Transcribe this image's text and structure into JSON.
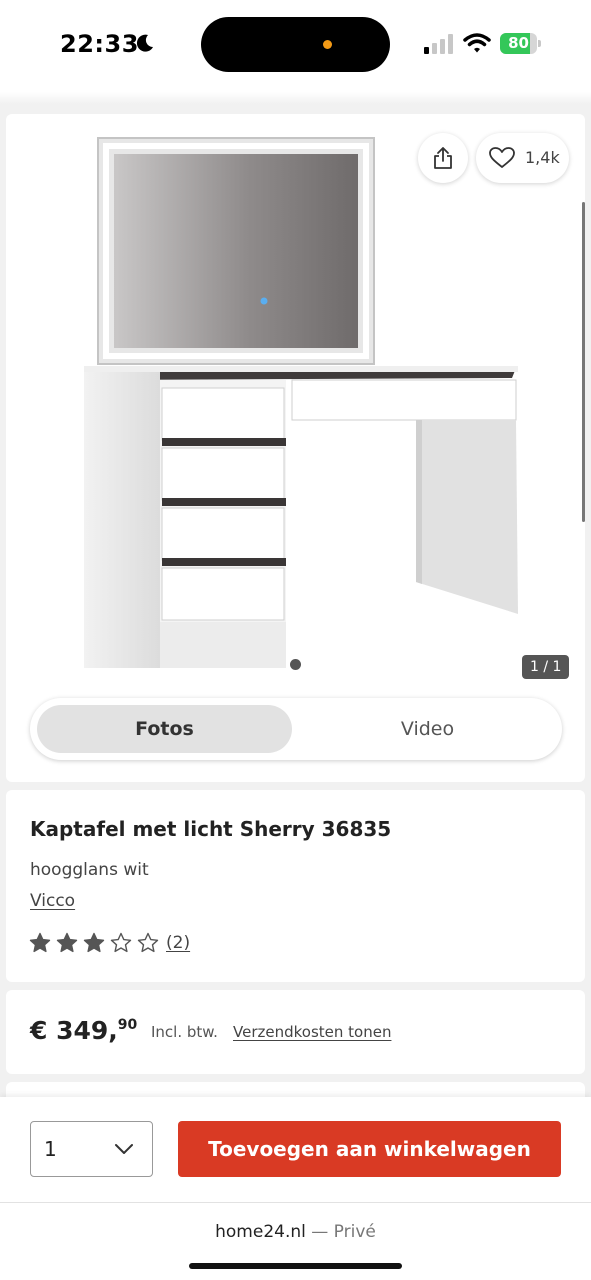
{
  "status_bar": {
    "time": "22:33",
    "battery": "80",
    "battery_level": 0.8,
    "icons": [
      "moon-icon",
      "signal-icon",
      "wifi-icon",
      "battery-icon"
    ]
  },
  "gallery": {
    "like_count": "1,4k",
    "image_counter": "1 / 1",
    "tabs": [
      {
        "label": "Fotos",
        "active": true
      },
      {
        "label": "Video",
        "active": false
      }
    ]
  },
  "product": {
    "title": "Kaptafel met licht Sherry 36835",
    "variant": "hoogglans wit",
    "brand": "Vicco",
    "rating": 3,
    "rating_max": 5,
    "review_count": "(2)"
  },
  "price": {
    "main": "€ 349,",
    "cents": "90",
    "vat": "Incl. btw.",
    "shipping_link": "Verzendkosten tonen"
  },
  "cart": {
    "quantity": "1",
    "add_button": "Toevoegen aan winkelwagen"
  },
  "browser": {
    "domain": "home24.nl",
    "separator": " — Privé"
  },
  "colors": {
    "accent": "#d93a24",
    "battery_green": "#34c759",
    "star": "#555555"
  }
}
